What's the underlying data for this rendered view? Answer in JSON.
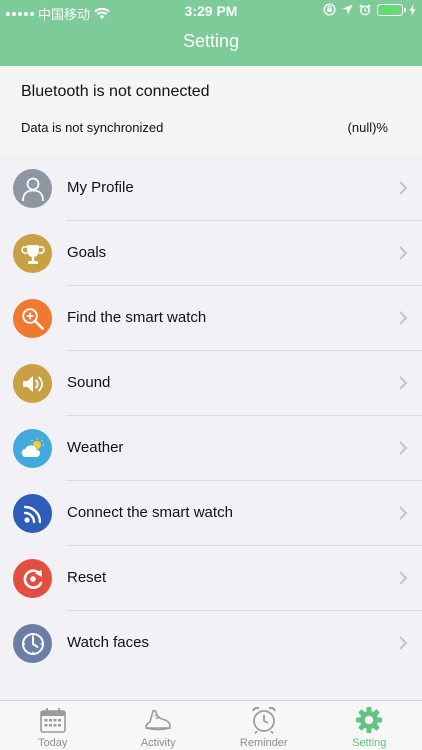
{
  "status_bar": {
    "carrier": "中国移动",
    "time": "3:29 PM"
  },
  "header": {
    "title": "Setting"
  },
  "connection": {
    "bluetooth_status": "Bluetooth is not connected",
    "sync_status": "Data is not synchronized",
    "percentage": "(null)%"
  },
  "menu": {
    "items": [
      {
        "label": "My Profile",
        "icon": "profile-icon",
        "color": "#8e95a3"
      },
      {
        "label": "Goals",
        "icon": "trophy-icon",
        "color": "#c9a144"
      },
      {
        "label": "Find the smart watch",
        "icon": "search-zoom-icon",
        "color": "#ef7a2f"
      },
      {
        "label": "Sound",
        "icon": "speaker-icon",
        "color": "#c9a144"
      },
      {
        "label": "Weather",
        "icon": "weather-icon",
        "color": "#43a8dc"
      },
      {
        "label": "Connect the smart watch",
        "icon": "connect-icon",
        "color": "#2d5db8"
      },
      {
        "label": "Reset",
        "icon": "reset-icon",
        "color": "#e24e3f"
      },
      {
        "label": "Watch faces",
        "icon": "clock-icon",
        "color": "#6b7ea8"
      }
    ]
  },
  "tabs": [
    {
      "label": "Today",
      "icon": "calendar-icon",
      "active": false
    },
    {
      "label": "Activity",
      "icon": "shoe-icon",
      "active": false
    },
    {
      "label": "Reminder",
      "icon": "alarm-clock-icon",
      "active": false
    },
    {
      "label": "Setting",
      "icon": "gear-icon",
      "active": true
    }
  ],
  "colors": {
    "header": "#7ccb98",
    "active_tab": "#61c384",
    "inactive_tab": "#8d8d8d"
  }
}
